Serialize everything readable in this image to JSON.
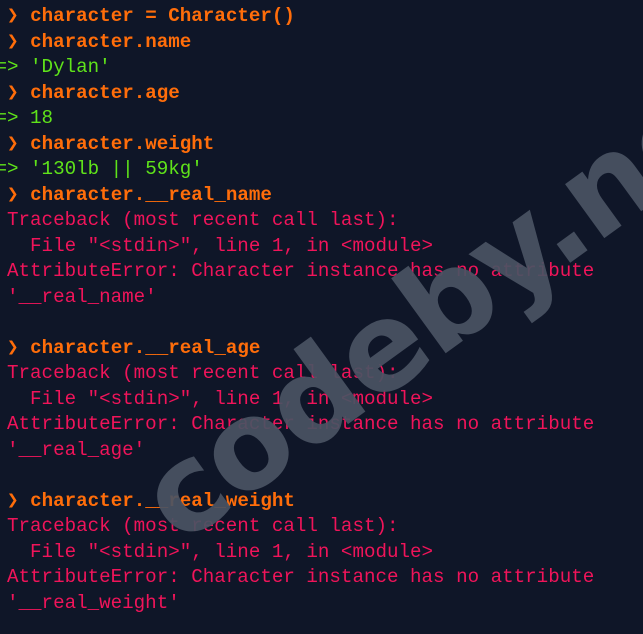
{
  "colors": {
    "background": "#0f1628",
    "input": "#ff6d0a",
    "output": "#5fe31a",
    "error": "#f0145a",
    "watermark": "#4a5363"
  },
  "prompt_symbol": " ❯ ",
  "result_symbol": "=> ",
  "lines": [
    {
      "type": "in",
      "text": "character = Character()"
    },
    {
      "type": "in",
      "text": "character.name"
    },
    {
      "type": "out",
      "text": "'Dylan'"
    },
    {
      "type": "in",
      "text": "character.age"
    },
    {
      "type": "out",
      "text": "18"
    },
    {
      "type": "in",
      "text": "character.weight"
    },
    {
      "type": "out",
      "text": "'130lb || 59kg'"
    },
    {
      "type": "in",
      "text": "character.__real_name"
    },
    {
      "type": "err",
      "text": " Traceback (most recent call last):"
    },
    {
      "type": "err",
      "text": "   File \"<stdin>\", line 1, in <module>"
    },
    {
      "type": "err",
      "text": " AttributeError: Character instance has no attribute"
    },
    {
      "type": "err",
      "text": " '__real_name'"
    },
    {
      "type": "blank",
      "text": ""
    },
    {
      "type": "in",
      "text": "character.__real_age"
    },
    {
      "type": "err",
      "text": " Traceback (most recent call last):"
    },
    {
      "type": "err",
      "text": "   File \"<stdin>\", line 1, in <module>"
    },
    {
      "type": "err",
      "text": " AttributeError: Character instance has no attribute"
    },
    {
      "type": "err",
      "text": " '__real_age'"
    },
    {
      "type": "blank",
      "text": ""
    },
    {
      "type": "in",
      "text": "character.__real_weight"
    },
    {
      "type": "err",
      "text": " Traceback (most recent call last):"
    },
    {
      "type": "err",
      "text": "   File \"<stdin>\", line 1, in <module>"
    },
    {
      "type": "err",
      "text": " AttributeError: Character instance has no attribute"
    },
    {
      "type": "err",
      "text": " '__real_weight'"
    }
  ],
  "watermark": "codeby.net"
}
